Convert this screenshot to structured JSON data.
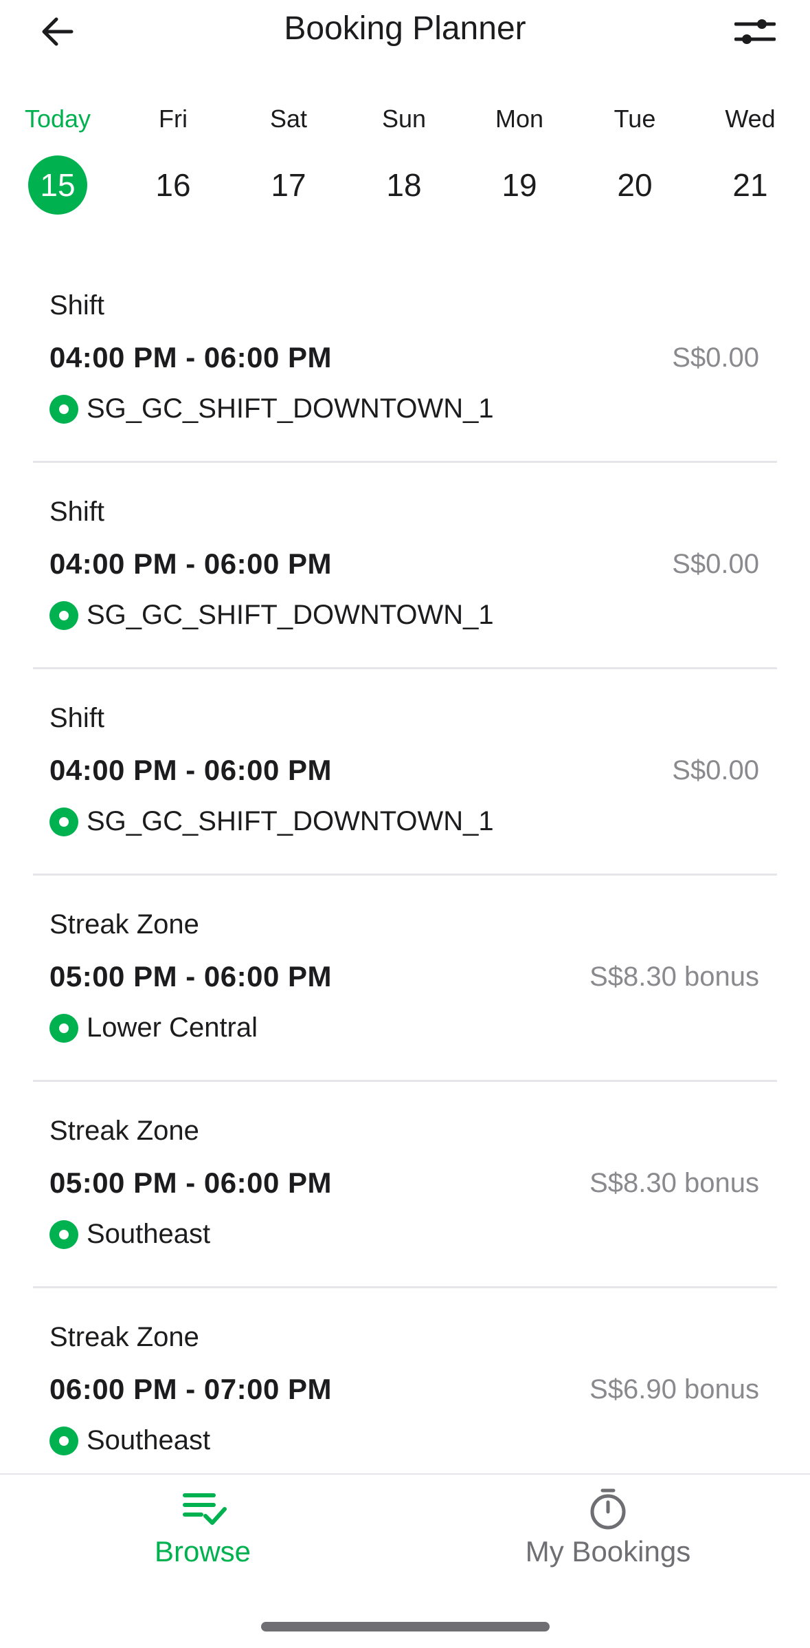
{
  "header": {
    "title": "Booking Planner",
    "back_icon": "arrow-left-icon",
    "filter_icon": "sliders-icon"
  },
  "days": [
    {
      "name": "Today",
      "num": "15",
      "selected": true
    },
    {
      "name": "Fri",
      "num": "16",
      "selected": false
    },
    {
      "name": "Sat",
      "num": "17",
      "selected": false
    },
    {
      "name": "Sun",
      "num": "18",
      "selected": false
    },
    {
      "name": "Mon",
      "num": "19",
      "selected": false
    },
    {
      "name": "Tue",
      "num": "20",
      "selected": false
    },
    {
      "name": "Wed",
      "num": "21",
      "selected": false
    }
  ],
  "bookings": [
    {
      "type": "Shift",
      "time": "04:00 PM - 06:00 PM",
      "amount": "S$0.00",
      "location": "SG_GC_SHIFT_DOWNTOWN_1"
    },
    {
      "type": "Shift",
      "time": "04:00 PM - 06:00 PM",
      "amount": "S$0.00",
      "location": "SG_GC_SHIFT_DOWNTOWN_1"
    },
    {
      "type": "Shift",
      "time": "04:00 PM - 06:00 PM",
      "amount": "S$0.00",
      "location": "SG_GC_SHIFT_DOWNTOWN_1"
    },
    {
      "type": "Streak Zone",
      "time": "05:00 PM - 06:00 PM",
      "amount": "S$8.30 bonus",
      "location": "Lower Central"
    },
    {
      "type": "Streak Zone",
      "time": "05:00 PM - 06:00 PM",
      "amount": "S$8.30 bonus",
      "location": "Southeast"
    },
    {
      "type": "Streak Zone",
      "time": "06:00 PM - 07:00 PM",
      "amount": "S$6.90 bonus",
      "location": "Southeast"
    }
  ],
  "tabs": [
    {
      "label": "Browse",
      "icon": "list-check-icon",
      "active": true
    },
    {
      "label": "My Bookings",
      "icon": "stopwatch-icon",
      "active": false
    }
  ],
  "colors": {
    "accent": "#00b14f",
    "text": "#1c1c1e",
    "muted": "#8a8a8e",
    "divider": "#e5e5ea"
  }
}
